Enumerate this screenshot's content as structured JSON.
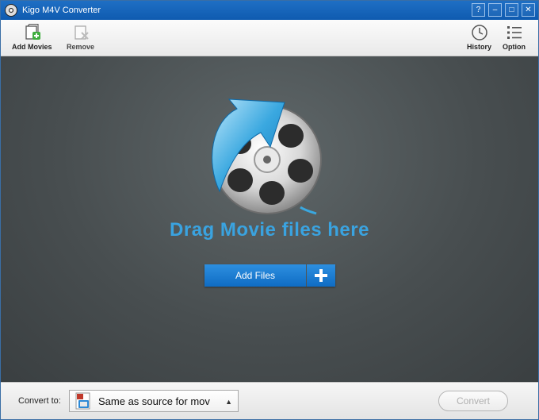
{
  "window": {
    "title": "Kigo M4V Converter"
  },
  "win_controls": {
    "help": "?",
    "minimize": "–",
    "maximize": "□",
    "close": "✕"
  },
  "toolbar": {
    "add_movies": "Add Movies",
    "remove": "Remove",
    "history": "History",
    "option": "Option"
  },
  "drop_area": {
    "text": "Drag Movie files here",
    "add_files_label": "Add Files",
    "add_files_plus": "+"
  },
  "bottom": {
    "convert_to_label": "Convert to:",
    "format_value": "Same as source for mov",
    "convert_button": "Convert"
  },
  "colors": {
    "accent_blue": "#3aa3e0",
    "title_bar": "#1f6fc4",
    "button_blue": "#1a7fd6"
  },
  "icons": {
    "add_movies": "add-movie-icon",
    "remove": "remove-icon",
    "history": "clock-icon",
    "option": "list-icon",
    "drop_art": "film-reel-arrow-icon"
  }
}
